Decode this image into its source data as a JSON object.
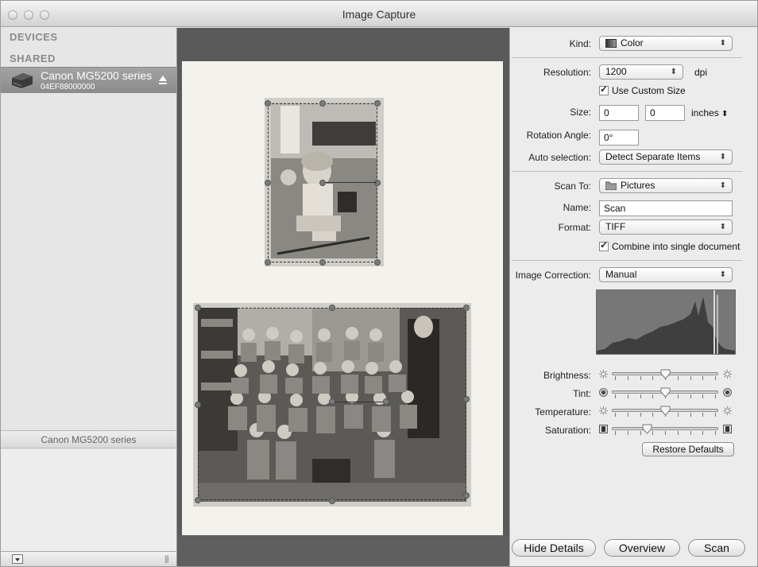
{
  "window": {
    "title": "Image Capture"
  },
  "sidebar": {
    "devices_header": "DEVICES",
    "shared_header": "SHARED",
    "device": {
      "name": "Canon MG5200 series",
      "id": "04EF88000000"
    },
    "footer_label": "Canon MG5200 series"
  },
  "settings": {
    "kind": {
      "label": "Kind:",
      "value": "Color"
    },
    "resolution": {
      "label": "Resolution:",
      "value": "1200",
      "unit": "dpi"
    },
    "use_custom_size": {
      "label": "Use Custom Size",
      "checked": true
    },
    "size": {
      "label": "Size:",
      "width": "0",
      "height": "0",
      "unit": "inches"
    },
    "rotation": {
      "label": "Rotation Angle:",
      "value": "0°"
    },
    "auto_selection": {
      "label": "Auto selection:",
      "value": "Detect Separate Items"
    },
    "scan_to": {
      "label": "Scan To:",
      "value": "Pictures"
    },
    "name": {
      "label": "Name:",
      "value": "Scan"
    },
    "format": {
      "label": "Format:",
      "value": "TIFF"
    },
    "combine": {
      "label": "Combine into single document",
      "checked": true
    },
    "image_correction": {
      "label": "Image Correction:",
      "value": "Manual"
    },
    "brightness": {
      "label": "Brightness:",
      "level": 0.5
    },
    "tint": {
      "label": "Tint:",
      "level": 0.5
    },
    "temperature": {
      "label": "Temperature:",
      "level": 0.5
    },
    "saturation": {
      "label": "Saturation:",
      "level": 0.33
    },
    "restore_defaults": "Restore Defaults"
  },
  "bottom_buttons": {
    "hide_details": "Hide Details",
    "overview": "Overview",
    "scan": "Scan"
  },
  "icons": {
    "kind": "color-swatch-icon",
    "scan_to": "folder-icon",
    "eject": "eject-icon",
    "device": "scanner-icon"
  },
  "colors": {
    "selection_bg": "#949494",
    "window_bg": "#ececec",
    "preview_bg": "#5a5a5a"
  }
}
